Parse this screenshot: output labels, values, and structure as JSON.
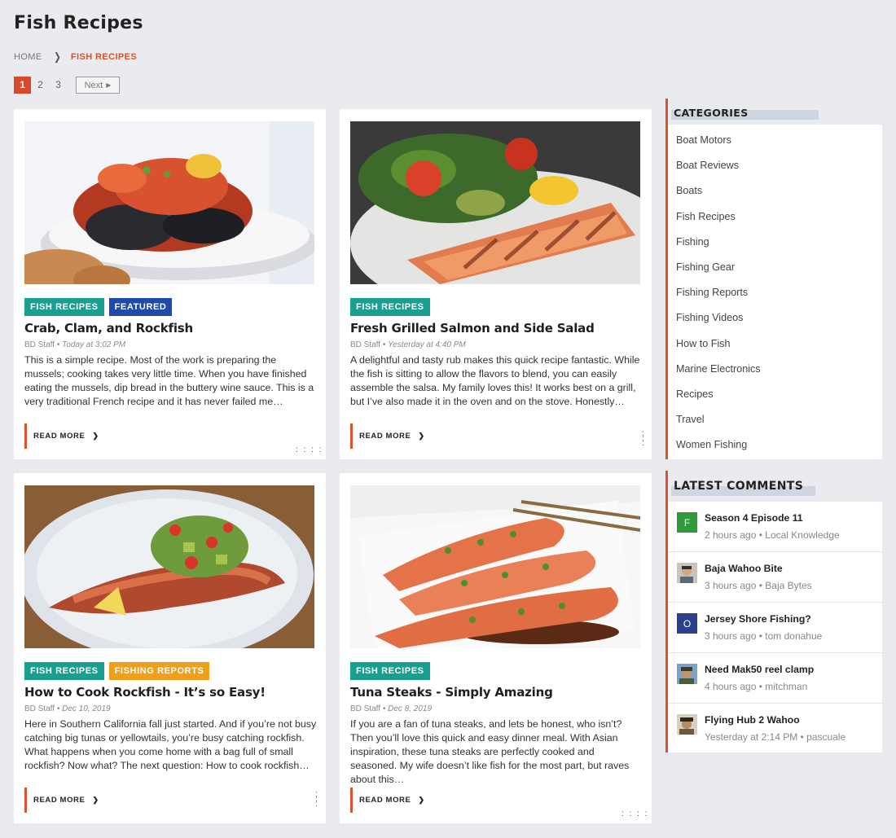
{
  "page": {
    "title": "Fish Recipes"
  },
  "breadcrumb": {
    "home": "HOME",
    "current": "FISH RECIPES"
  },
  "pagination": {
    "pages": [
      "1",
      "2",
      "3"
    ],
    "active": "1",
    "next": "Next"
  },
  "read_more": "READ MORE",
  "posts": [
    {
      "tags": [
        {
          "label": "FISH RECIPES",
          "color": "#199e8f"
        },
        {
          "label": "FEATURED",
          "color": "#1f4aa8"
        }
      ],
      "title": "Crab, Clam, and Rockfish",
      "author": "BD Staff",
      "date": "Today at 3:02 PM",
      "excerpt": "This is a simple recipe. Most of the work is preparing the mussels; cooking takes very little time. When you have finished eating the mussels, dip bread in the buttery wine sauce. This is a very traditional French recipe and it has never failed me…"
    },
    {
      "tags": [
        {
          "label": "FISH RECIPES",
          "color": "#199e8f"
        }
      ],
      "title": "Fresh Grilled Salmon and Side Salad",
      "author": "BD Staff",
      "date": "Yesterday at 4:40 PM",
      "excerpt": "A delightful and tasty rub makes this quick recipe fantastic. While the fish is sitting to allow the flavors to blend, you can easily assemble the salsa. My family loves this! It works best on a grill, but I’ve also made it in the oven and on the stove. Honestly…"
    },
    {
      "tags": [
        {
          "label": "FISH RECIPES",
          "color": "#199e8f"
        },
        {
          "label": "FISHING REPORTS",
          "color": "#eea01d"
        }
      ],
      "title": "How to Cook Rockfish - It’s so Easy!",
      "author": "BD Staff",
      "date": "Dec 10, 2019",
      "excerpt": "Here in Southern California fall just started. And if you’re not busy catching big tunas or yellowtails, you’re busy catching rockfish. What happens when you come home with a bag full of small rockfish? Now what?  The next question: How to cook rockfish…"
    },
    {
      "tags": [
        {
          "label": "FISH RECIPES",
          "color": "#199e8f"
        }
      ],
      "title": "Tuna Steaks - Simply Amazing",
      "author": "BD Staff",
      "date": "Dec 8, 2019",
      "excerpt": "If you are a fan of tuna steaks, and lets be honest, who isn’t? Then you’ll love this quick and easy dinner meal. With Asian inspiration, these tuna steaks are perfectly cooked and seasoned. My wife doesn’t like fish for the most part, but raves about this…"
    }
  ],
  "categories": {
    "heading": "CATEGORIES",
    "items": [
      "Boat Motors",
      "Boat Reviews",
      "Boats",
      "Fish Recipes",
      "Fishing",
      "Fishing Gear",
      "Fishing Reports",
      "Fishing Videos",
      "How to Fish",
      "Marine Electronics",
      "Recipes",
      "Travel",
      "Women Fishing"
    ]
  },
  "latest_comments": {
    "heading": "LATEST COMMENTS",
    "items": [
      {
        "title": "Season 4 Episode 11",
        "time": "2 hours ago",
        "user": "Local Knowledge",
        "avatar": "F",
        "avatar_color": "#2e9a3a"
      },
      {
        "title": "Baja Wahoo Bite",
        "time": "3 hours ago",
        "user": "Baja Bytes",
        "avatar": "",
        "avatar_color": "#b9a58c"
      },
      {
        "title": "Jersey Shore Fishing?",
        "time": "3 hours ago",
        "user": "tom donahue",
        "avatar": "O",
        "avatar_color": "#2b3f8f"
      },
      {
        "title": "Need Mak50 reel clamp",
        "time": "4 hours ago",
        "user": "mitchman",
        "avatar": "",
        "avatar_color": "#8a7a55"
      },
      {
        "title": "Flying Hub 2 Wahoo",
        "time": "Yesterday at 2:14 PM",
        "user": "pascuale",
        "avatar": "",
        "avatar_color": "#6b5a3e"
      }
    ]
  }
}
